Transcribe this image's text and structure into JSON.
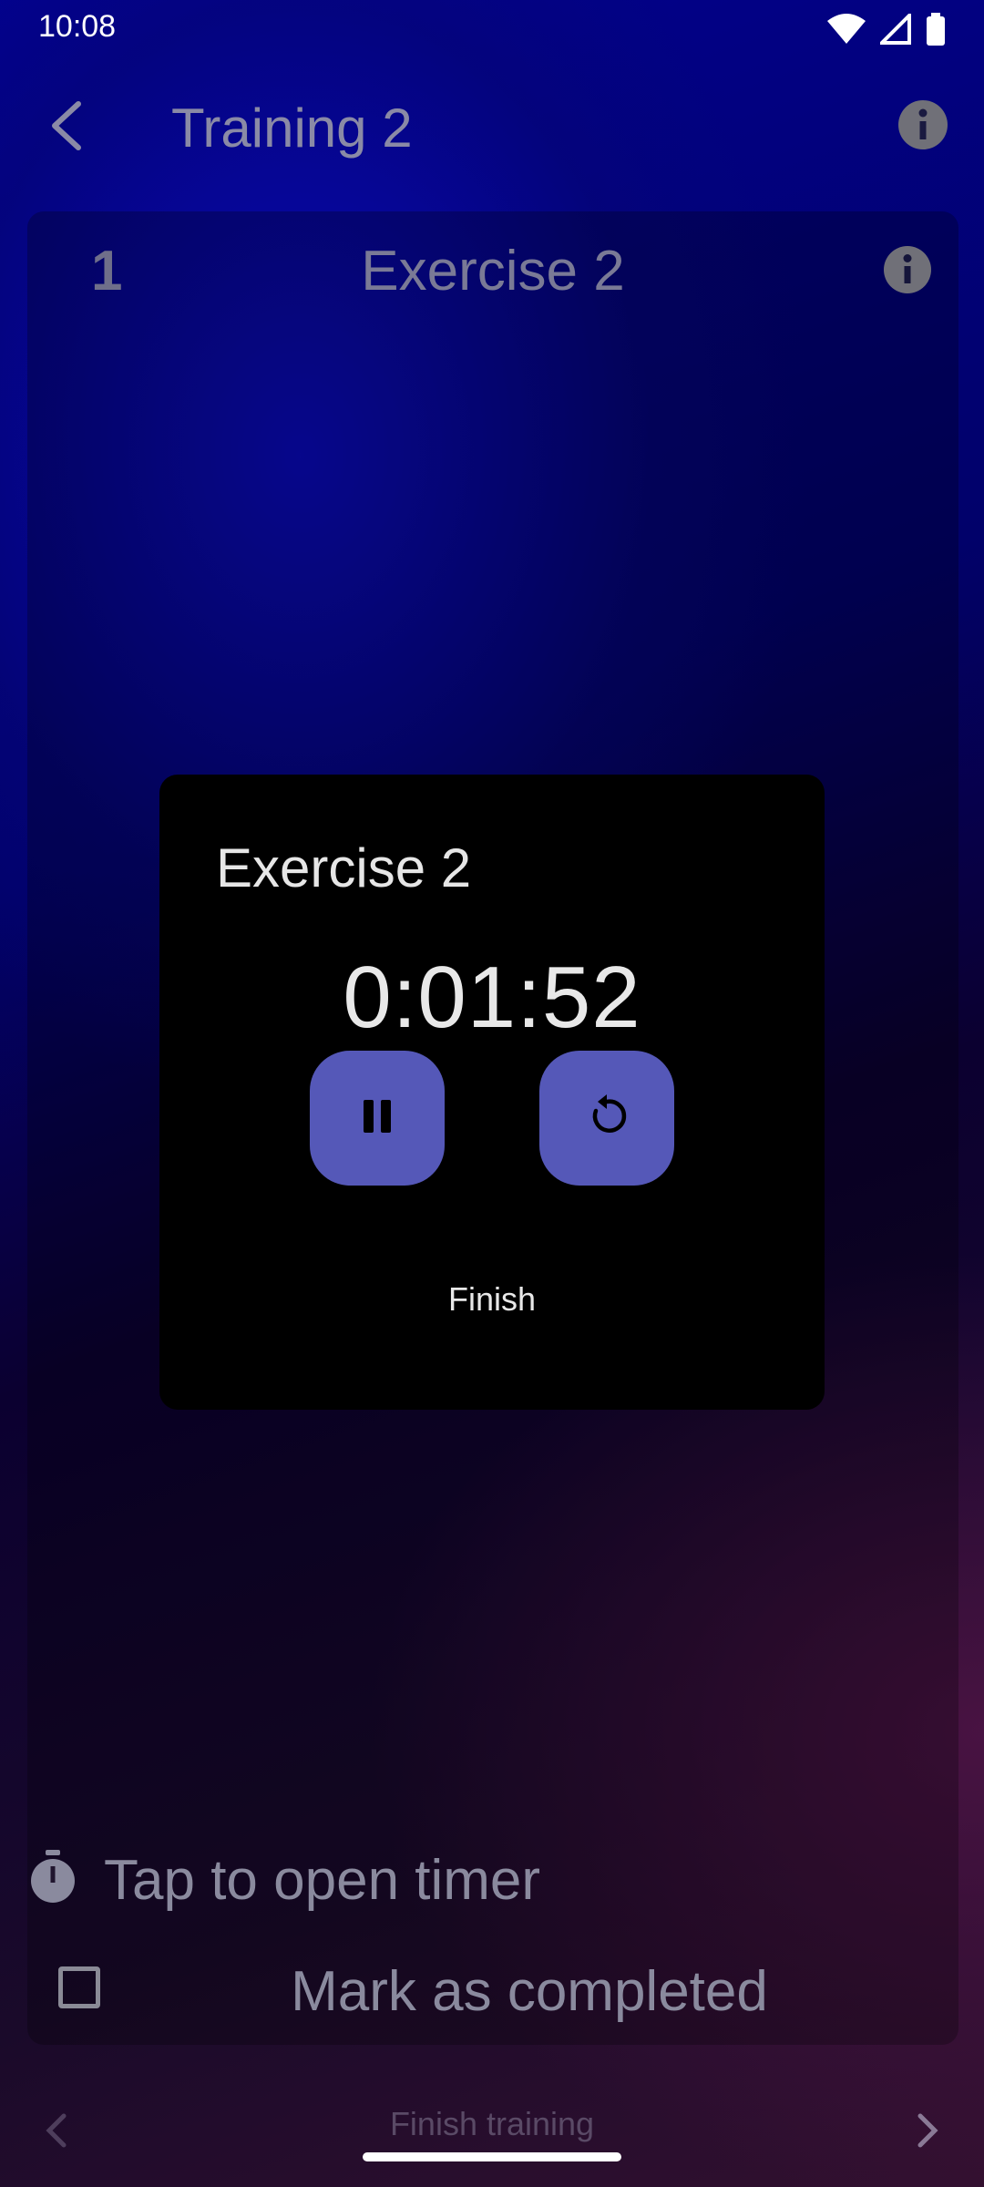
{
  "status_bar": {
    "time": "10:08",
    "icons": [
      "wifi-icon",
      "cellular-signal-icon",
      "battery-icon"
    ]
  },
  "app_bar": {
    "title": "Training 2",
    "back_icon": "back-arrow-icon",
    "info_icon": "info-icon"
  },
  "exercise_card": {
    "number": "1",
    "title": "Exercise 2",
    "timer_label": "Tap to open timer",
    "complete_label": "Mark as completed",
    "completed": false
  },
  "bottom_nav": {
    "finish_label": "Finish training"
  },
  "timer_dialog": {
    "title": "Exercise 2",
    "time": "0:01:52",
    "pause_icon": "pause-icon",
    "reset_icon": "reset-icon",
    "finish_label": "Finish"
  },
  "colors": {
    "accent": "#5558b8",
    "dialog_bg": "#000000"
  }
}
